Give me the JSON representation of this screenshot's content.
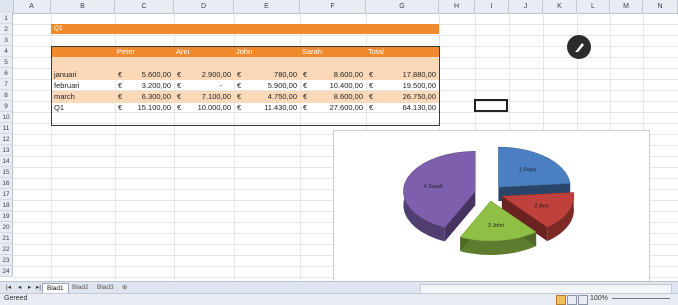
{
  "columns": [
    "A",
    "B",
    "C",
    "D",
    "E",
    "F",
    "G",
    "H",
    "I",
    "J",
    "K",
    "L",
    "M",
    "N"
  ],
  "rows": [
    "1",
    "2",
    "3",
    "4",
    "5",
    "6",
    "7",
    "8",
    "9",
    "10",
    "11",
    "12",
    "13",
    "14",
    "15",
    "16",
    "17",
    "18",
    "19",
    "20",
    "21",
    "22",
    "23",
    "24"
  ],
  "sheet": {
    "title_cell": "Q1",
    "headers": [
      "Peter",
      "Ann",
      "John",
      "Sarah",
      "Total"
    ],
    "data_rows": [
      {
        "label": "januari",
        "values": [
          "5.600,00",
          "2.900,00",
          "780,00",
          "8.600,00",
          "17.880,00"
        ]
      },
      {
        "label": "februari",
        "values": [
          "3.200,00",
          "-",
          "5.900,00",
          "10.400,00",
          "19.500,00"
        ]
      },
      {
        "label": "march",
        "values": [
          "6.300,00",
          "7.100,00",
          "4.750,00",
          "8.600,00",
          "26.750,00"
        ]
      },
      {
        "label": "Q1",
        "values": [
          "15.100,00",
          "10.000,00",
          "11.430,00",
          "27.600,00",
          "64.130,00"
        ]
      }
    ],
    "currency": "€"
  },
  "chart_data": {
    "type": "pie",
    "categories": [
      "1 Peter",
      "2 Ann",
      "3 John",
      "4 Sarah"
    ],
    "values": [
      15100,
      10000,
      11430,
      27600
    ],
    "colors": [
      "#4a7fc1",
      "#c0403c",
      "#8fbf45",
      "#7d5fad"
    ]
  },
  "tabs": [
    "Blad1",
    "Blad2",
    "Blad3"
  ],
  "status": {
    "mode": "Gereed",
    "zoom": "100%"
  },
  "tab_nav": [
    "|◂",
    "◂",
    "▸",
    "▸|"
  ]
}
